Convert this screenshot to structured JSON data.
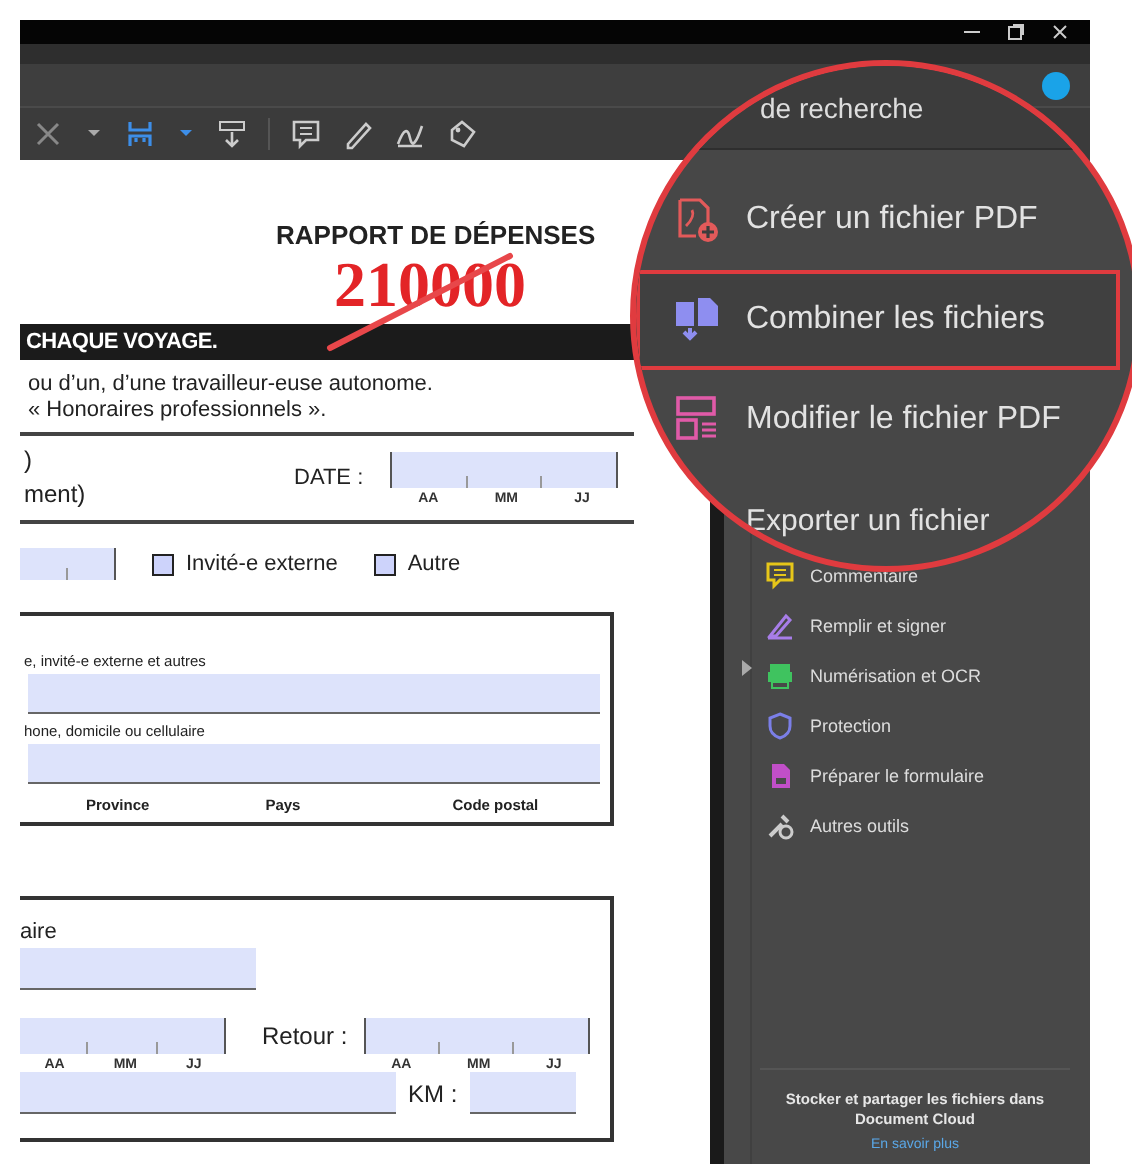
{
  "document": {
    "title": "RAPPORT DE DÉPENSES",
    "stamp": "210000",
    "banner": "CHAQUE VOYAGE.",
    "intro": [
      "ou d’un, d’une travailleur-euse autonome.",
      "« Honoraires professionnels »."
    ],
    "name_lines": [
      ")",
      "ment)"
    ],
    "date_label": "DATE :",
    "date_parts": [
      "AA",
      "MM",
      "JJ"
    ],
    "checkboxes": [
      {
        "label": "Invité-e externe",
        "checked": false
      },
      {
        "label": "Autre",
        "checked": false
      }
    ],
    "contact_box": {
      "labels": [
        "e, invité-e externe  et autres",
        "hone, domicile ou cellulaire"
      ],
      "address_parts": [
        "Province",
        "Pays",
        "Code postal"
      ]
    },
    "trip_box": {
      "label": "aire",
      "departure_parts": [
        "AA",
        "MM",
        "JJ"
      ],
      "return_label": "Retour :",
      "return_parts": [
        "AA",
        "MM",
        "JJ"
      ],
      "km_label": "KM :"
    }
  },
  "tools_panel": {
    "items": [
      {
        "kind": "comment",
        "label": "Commentaire"
      },
      {
        "kind": "sign",
        "label": "Remplir et signer"
      },
      {
        "kind": "scan",
        "label": "Numérisation et OCR"
      },
      {
        "kind": "protect",
        "label": "Protection"
      },
      {
        "kind": "form",
        "label": "Préparer le formulaire"
      },
      {
        "kind": "more",
        "label": "Autres outils"
      }
    ],
    "cloud_note": "Stocker et partager les fichiers dans Document Cloud",
    "link": "En savoir plus"
  },
  "magnifier": {
    "search_text": "de recherche",
    "items": [
      {
        "kind": "create",
        "label": "Créer un fichier PDF",
        "selected": false
      },
      {
        "kind": "combine",
        "label": "Combiner les fichiers",
        "selected": true
      },
      {
        "kind": "edit",
        "label": "Modifier le fichier PDF",
        "selected": false
      },
      {
        "kind": "export",
        "label": "Exporter un fichier",
        "selected": false
      }
    ]
  }
}
